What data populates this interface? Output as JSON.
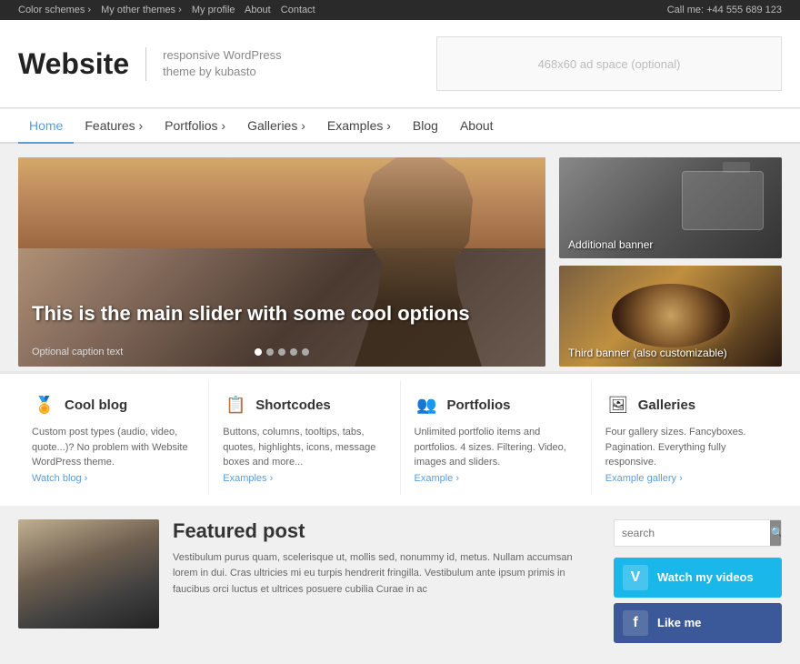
{
  "topbar": {
    "links": [
      {
        "label": "Color schemes ›",
        "id": "color-schemes"
      },
      {
        "label": "My other themes ›",
        "id": "other-themes"
      },
      {
        "label": "My profile",
        "id": "my-profile"
      },
      {
        "label": "About",
        "id": "about-top"
      },
      {
        "label": "Contact",
        "id": "contact-top"
      }
    ],
    "phone": "Call me: +44 555 689 123"
  },
  "header": {
    "logo": "Website",
    "subtitle_line1": "responsive WordPress",
    "subtitle_line2": "theme by kubasto",
    "ad_text": "468x60 ad space (optional)"
  },
  "nav": {
    "items": [
      {
        "label": "Home",
        "active": true
      },
      {
        "label": "Features ›",
        "active": false
      },
      {
        "label": "Portfolios ›",
        "active": false
      },
      {
        "label": "Galleries ›",
        "active": false
      },
      {
        "label": "Examples ›",
        "active": false
      },
      {
        "label": "Blog",
        "active": false
      },
      {
        "label": "About",
        "active": false
      }
    ]
  },
  "slider": {
    "heading": "This is the main slider with some cool options",
    "caption": "Optional caption text",
    "dots": 5
  },
  "banners": [
    {
      "label": "Additional banner",
      "id": "banner-1"
    },
    {
      "label": "Third banner (also customizable)",
      "id": "banner-2"
    }
  ],
  "features": [
    {
      "icon": "🏅",
      "title": "Cool blog",
      "text": "Custom post types (audio, video, quote...)? No problem with Website WordPress theme.",
      "link": "Watch blog ›",
      "id": "cool-blog"
    },
    {
      "icon": "📋",
      "title": "Shortcodes",
      "text": "Buttons, columns, tooltips, tabs, quotes, highlights, icons, message boxes and more...",
      "link": "Examples ›",
      "id": "shortcodes"
    },
    {
      "icon": "👥",
      "title": "Portfolios",
      "text": "Unlimited portfolio items and portfolios. 4 sizes. Filtering. Video, images and sliders.",
      "link": "Example ›",
      "id": "portfolios"
    },
    {
      "icon": "🖼",
      "title": "Galleries",
      "text": "Four gallery sizes. Fancyboxes. Pagination. Everything fully responsive.",
      "link": "Example gallery ›",
      "id": "galleries"
    }
  ],
  "featured_post": {
    "title": "Featured post",
    "body": "Vestibulum purus quam, scelerisque ut, mollis sed, nonummy id, metus. Nullam accumsan lorem in dui. Cras ultricies mi eu turpis hendrerit fringilla. Vestibulum ante ipsum primis in faucibus orci luctus et ultrices posuere cubilia Curae in ac"
  },
  "sidebar": {
    "search_placeholder": "search",
    "search_btn_icon": "🔍",
    "social": [
      {
        "label": "Watch my videos",
        "platform": "vimeo",
        "icon": "V"
      },
      {
        "label": "Like me",
        "platform": "facebook",
        "icon": "f"
      }
    ]
  },
  "colors": {
    "accent": "#5b9dd9",
    "topbar_bg": "#2a2a2a",
    "vimeo": "#1ab7ea",
    "facebook": "#3b5998"
  }
}
